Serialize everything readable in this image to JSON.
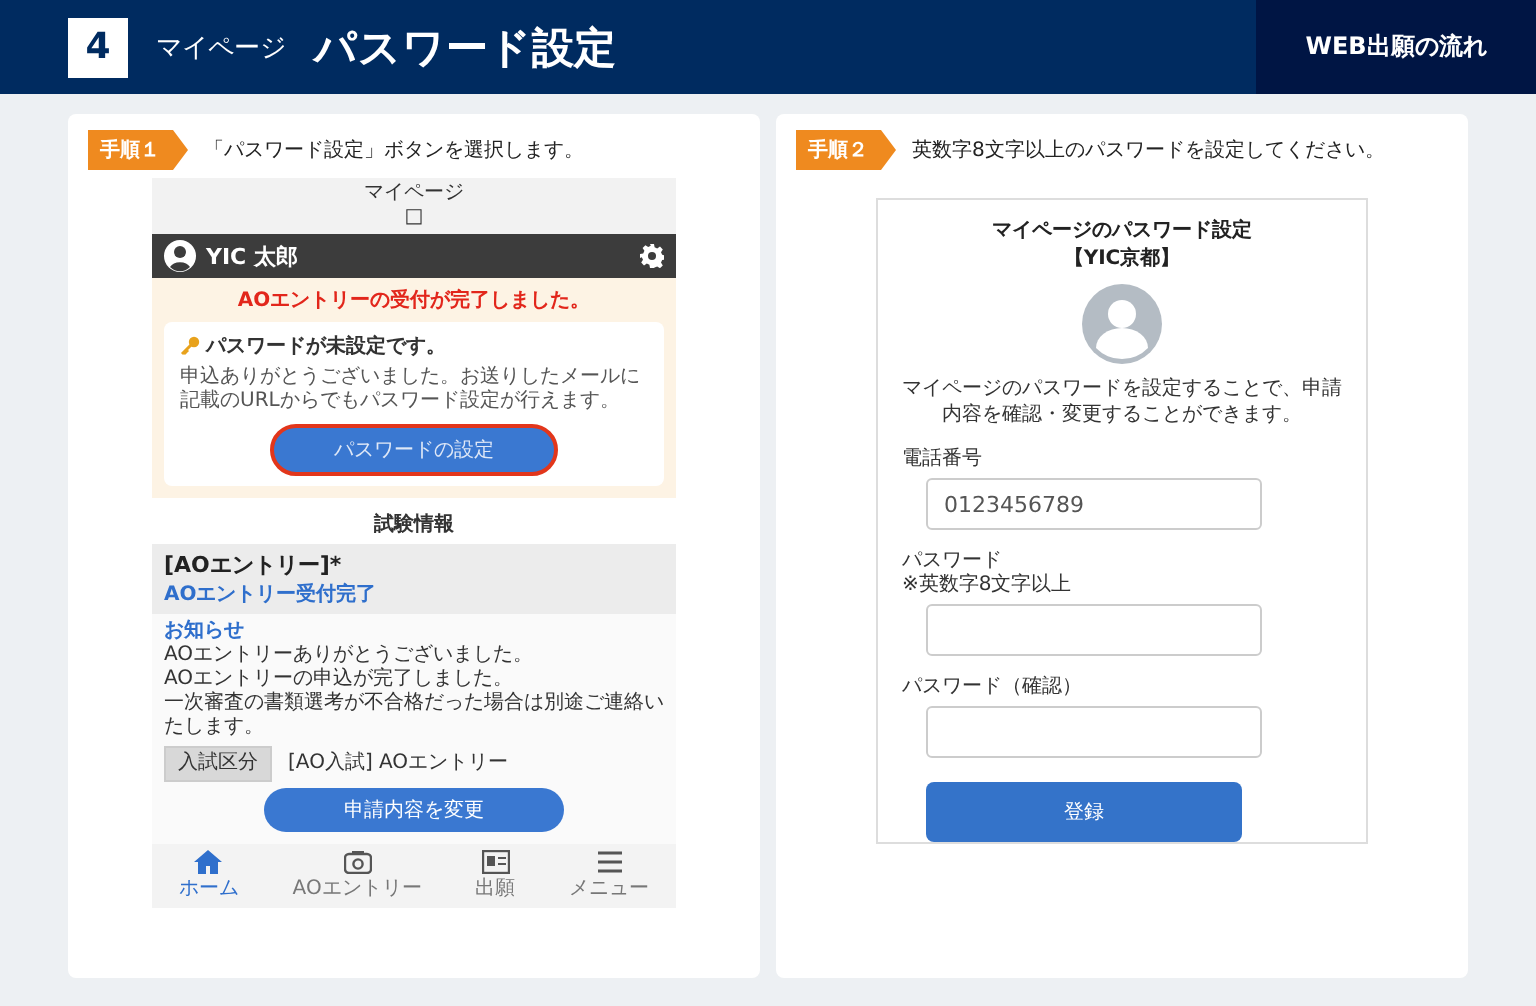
{
  "header": {
    "step_number": "4",
    "section": "マイページ",
    "title": "パスワード設定",
    "flow_label": "WEB出願の流れ"
  },
  "steps": [
    {
      "badge": "手順１",
      "instruction": "「パスワード設定」ボタンを選択します。",
      "screen": {
        "kind": "mypage",
        "title": "マイページ",
        "title_glyph": "□",
        "user_name": "YIC 太郎",
        "notice": "AOエントリーの受付が完了しました。",
        "card_title": "パスワードが未設定です。",
        "card_text": "申込ありがとうございました。お送りしたメールに記載のURLからでもパスワード設定が行えます。",
        "button": {
          "label": "パスワードの設定",
          "highlighted": true
        },
        "exam": {
          "heading": "試験情報",
          "entry_title": "[AOエントリー]*",
          "entry_status": "AOエントリー受付完了",
          "notice_label": "お知らせ",
          "notice_lines": [
            "AOエントリーありがとうございました。",
            "AOエントリーの申込が完了しました。",
            "一次審査の書類選考が不合格だった場合は別途ご連絡いたします。"
          ],
          "field_label": "入試区分",
          "field_value": "[AO入試] AOエントリー",
          "button": "申請内容を変更"
        },
        "nav": [
          {
            "label": "ホーム",
            "selected": true
          },
          {
            "label": "AOエントリー",
            "selected": false
          },
          {
            "label": "出願",
            "selected": false
          },
          {
            "label": "メニュー",
            "selected": false
          }
        ]
      }
    },
    {
      "badge": "手順２",
      "instruction": "英数字8文字以上のパスワードを設定してください。",
      "screen": {
        "kind": "form",
        "title": "マイページのパスワード設定",
        "subtitle": "【YIC京都】",
        "description": "マイページのパスワードを設定することで、申請内容を確認・変更することができます。",
        "fields": [
          {
            "label": "電話番号",
            "value": "0123456789"
          },
          {
            "label": "パスワード",
            "note": "※英数字8文字以上"
          },
          {
            "label": "パスワード（確認）"
          }
        ],
        "submit": "登録"
      }
    }
  ]
}
